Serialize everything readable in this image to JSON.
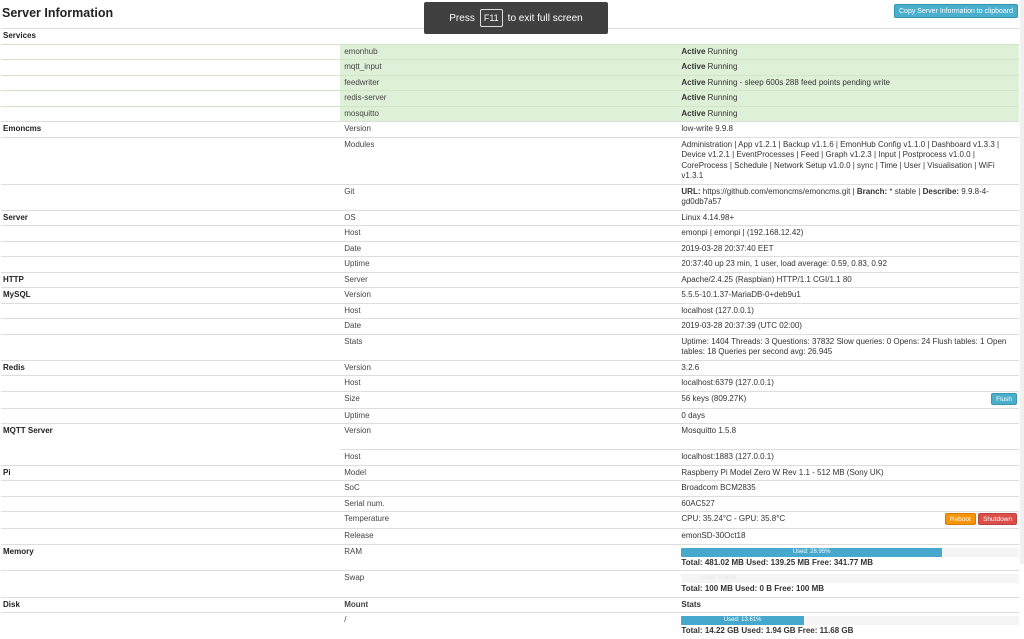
{
  "page": {
    "title": "Server Information",
    "copy_button": "Copy Server Information to clipboard"
  },
  "overlay": {
    "press": "Press",
    "key": "F11",
    "rest": "to exit full screen"
  },
  "services": {
    "label": "Services",
    "items": [
      {
        "name": "emonhub",
        "state": "Active",
        "detail": "Running"
      },
      {
        "name": "mqtt_input",
        "state": "Active",
        "detail": "Running"
      },
      {
        "name": "feedwriter",
        "state": "Active",
        "detail": "Running - sleep 600s 288 feed points pending write"
      },
      {
        "name": "redis-server",
        "state": "Active",
        "detail": "Running"
      },
      {
        "name": "mosquitto",
        "state": "Active",
        "detail": "Running"
      }
    ]
  },
  "emoncms": {
    "label": "Emoncms",
    "version_label": "Version",
    "version": "low-write 9.9.8",
    "modules_label": "Modules",
    "modules": "Administration | App v1.2.1 | Backup v1.1.6 | EmonHub Config v1.1.0 | Dashboard v1.3.3 | Device v1.2.1 | EventProcesses | Feed | Graph v1.2.3 | Input | Postprocess v1.0.0 | CoreProcess | Schedule | Network Setup v1.0.0 | sync | Time | User | Visualisation | WiFi v1.3.1",
    "git_label": "Git",
    "git_url_label": "URL:",
    "git_url": "https://github.com/emoncms/emoncms.git |",
    "git_branch_label": "Branch:",
    "git_branch": "* stable |",
    "git_describe_label": "Describe:",
    "git_describe": "9.9.8-4-gd0db7a57"
  },
  "server": {
    "label": "Server",
    "os_label": "OS",
    "os": "Linux 4.14.98+",
    "host_label": "Host",
    "host": "emonpi | emonpi | (192.168.12.42)",
    "date_label": "Date",
    "date": "2019-03-28 20:37:40 EET",
    "uptime_label": "Uptime",
    "uptime": "20:37:40 up 23 min, 1 user, load average: 0.59, 0.83, 0.92"
  },
  "http": {
    "label": "HTTP",
    "server_label": "Server",
    "server": "Apache/2.4.25 (Raspbian) HTTP/1.1 CGI/1.1 80"
  },
  "mysql": {
    "label": "MySQL",
    "version_label": "Version",
    "version": "5.5.5-10.1.37-MariaDB-0+deb9u1",
    "host_label": "Host",
    "host": "localhost (127.0.0.1)",
    "date_label": "Date",
    "date": "2019-03-28 20:37:39 (UTC 02:00)",
    "stats_label": "Stats",
    "stats": "Uptime: 1404 Threads: 3 Questions: 37832 Slow queries: 0 Opens: 24 Flush tables: 1 Open tables: 18 Queries per second avg: 26.945"
  },
  "redis": {
    "label": "Redis",
    "version_label": "Version",
    "version": "3.2.6",
    "host_label": "Host",
    "host": "localhost:6379 (127.0.0.1)",
    "size_label": "Size",
    "size": "56 keys (809.27K)",
    "flush_button": "Flush",
    "uptime_label": "Uptime",
    "uptime": "0 days"
  },
  "mqtt": {
    "label": "MQTT Server",
    "version_label": "Version",
    "version": "Mosquitto 1.5.8",
    "host_label": "Host",
    "host": "localhost:1883 (127.0.0.1)"
  },
  "pi": {
    "label": "Pi",
    "model_label": "Model",
    "model": "Raspberry Pi Model Zero W Rev 1.1 - 512 MB (Sony UK)",
    "soc_label": "SoC",
    "soc": "Broadcom BCM2835",
    "serial_label": "Serial num.",
    "serial": "60AC527",
    "temp_label": "Temperature",
    "temp": "CPU: 35.24°C - GPU: 35.8°C",
    "reboot_button": "Reboot",
    "shutdown_button": "Shutdown",
    "release_label": "Release",
    "release": "emonSD-30Oct18"
  },
  "memory": {
    "label": "Memory",
    "ram_label": "RAM",
    "ram_bar": "Used: 28.95%",
    "ram_percent": 28.95,
    "ram_total_label": "Total:",
    "ram_total": "481.02 MB",
    "ram_used_label": "Used:",
    "ram_used": "139.25 MB",
    "ram_free_label": "Free:",
    "ram_free": "341.77 MB",
    "swap_label": "Swap",
    "swap_bar": "Used: 0.00%",
    "swap_percent": 0,
    "swap_total_label": "Total:",
    "swap_total": "100 MB",
    "swap_used_label": "Used:",
    "swap_used": "0 B",
    "swap_free_label": "Free:",
    "swap_free": "100 MB"
  },
  "disk": {
    "label": "Disk",
    "mount_header": "Mount",
    "stats_header": "Stats",
    "mount": "/",
    "bar": "Used: 13.61%",
    "percent": 13.61,
    "total_label": "Total:",
    "total": "14.22 GB",
    "used_label": "Used:",
    "used": "1.94 GB",
    "free_label": "Free:",
    "free": "11.68 GB"
  },
  "colors": {
    "services_bg": "#dff0d8",
    "info_button": "#49afcd",
    "warn_button": "#f89406",
    "danger_button": "#da4f49",
    "bar": "#45a8cc"
  }
}
